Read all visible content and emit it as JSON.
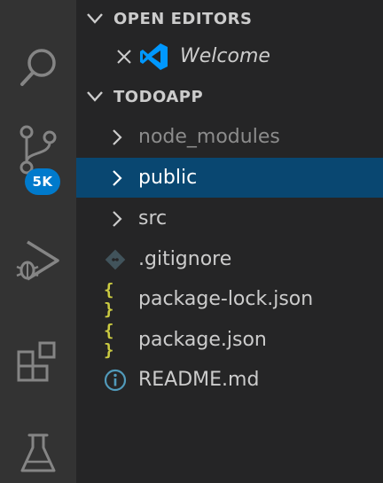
{
  "activity_bar": {
    "items": [
      {
        "name": "search",
        "icon": "search-icon"
      },
      {
        "name": "source-control",
        "icon": "source-control-icon",
        "badge": "5K"
      },
      {
        "name": "run-and-debug",
        "icon": "run-debug-icon"
      },
      {
        "name": "extensions",
        "icon": "extensions-icon"
      },
      {
        "name": "testing",
        "icon": "flask-icon"
      }
    ],
    "badge_color": "#007acc"
  },
  "open_editors": {
    "title": "OPEN EDITORS",
    "items": [
      {
        "label": "Welcome",
        "icon": "vscode-logo-icon"
      }
    ]
  },
  "workspace": {
    "title": "TODOAPP",
    "items": [
      {
        "label": "node_modules",
        "type": "folder",
        "icon": "chevron-right-icon"
      },
      {
        "label": "public",
        "type": "folder",
        "icon": "chevron-right-icon",
        "selected": true
      },
      {
        "label": "src",
        "type": "folder",
        "icon": "chevron-right-icon"
      },
      {
        "label": ".gitignore",
        "type": "file",
        "icon": "git-icon"
      },
      {
        "label": "package-lock.json",
        "type": "file",
        "icon": "json-icon",
        "glyph": "{ }"
      },
      {
        "label": "package.json",
        "type": "file",
        "icon": "json-icon",
        "glyph": "{ }"
      },
      {
        "label": "README.md",
        "type": "file",
        "icon": "info-icon"
      }
    ]
  },
  "colors": {
    "activity_bar_bg": "#333333",
    "sidebar_bg": "#252526",
    "selection_bg": "#094771",
    "text": "#cccccc",
    "json_icon": "#cbcb41",
    "info_icon": "#519aba",
    "vscode_blue": "#0098ff"
  }
}
